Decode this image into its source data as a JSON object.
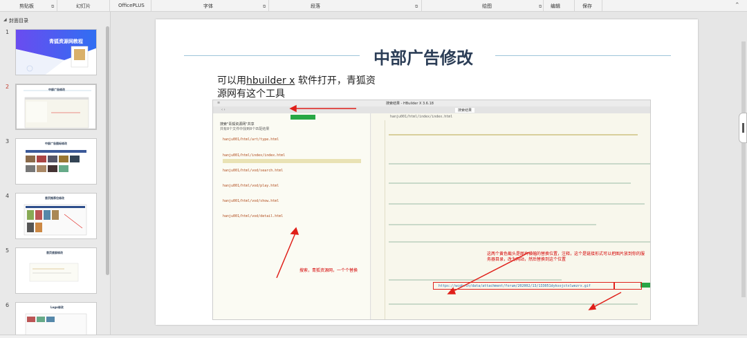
{
  "ribbon": {
    "groups": [
      "剪贴板",
      "幻灯片",
      "OfficePLUS",
      "字体",
      "段落",
      "绘图",
      "编辑",
      "保存"
    ]
  },
  "thumbnail_pane": {
    "title": "封面目录",
    "slides": [
      {
        "number": "1",
        "caption": "青狐资源网教程"
      },
      {
        "number": "2",
        "caption": "中部广告修改"
      },
      {
        "number": "3",
        "caption": "中部广告图标修改"
      },
      {
        "number": "4",
        "caption": "首页推荐位修改"
      },
      {
        "number": "5",
        "caption": "首页底部修改"
      },
      {
        "number": "6",
        "caption": "Logo修改"
      }
    ]
  },
  "slide": {
    "title": "中部广告修改",
    "body_line1_a": "可以用",
    "body_line1_u": "hbuilder x",
    "body_line1_b": "  软件打开，青狐资",
    "body_line2": "源网有这个工具",
    "screenshot": {
      "window_title": "搜索结果 - HBuilder X 3.6.18",
      "tab_label": "搜索结果",
      "path": "hanju001/html/index/index.html",
      "search_header": "搜索\"青狐资源网\"共享",
      "search_count": "共有8个文件中找到8个匹配结果",
      "results": [
        "hanju001/html/art/type.html",
        "hanju001/html/index/index.html",
        "hanju001/html/vod/search.html",
        "hanju001/html/vod/play.html",
        "hanju001/html/vod/show.html",
        "hanju001/html/vod/detail.html"
      ],
      "annotation_left": "搜索，青狐资源网，一个个替换",
      "annotation_right": "这两个黄色截头是图片横幅的替换位置，注释，这个是链接形式可以把图片放到你的服务器目录，改为网站，然后替换到这个位置",
      "code_url": "https://wcqh.cn/data/attachment/forum/202002/13/133051dyksojctxlwezrx.gif"
    }
  }
}
